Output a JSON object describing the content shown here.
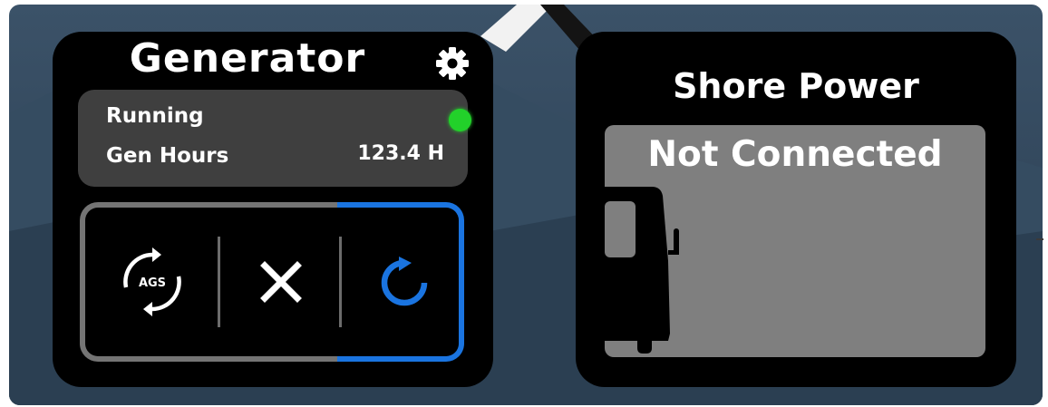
{
  "generator": {
    "title": "Generator",
    "status_label": "Running",
    "status_color": "#22d12a",
    "hours_label": "Gen Hours",
    "hours_value": "123.4 H",
    "settings_icon": "gear-icon",
    "modes": [
      {
        "name": "AGS",
        "label": "AGS",
        "icon": "ags-cycle-icon"
      },
      {
        "name": "Off",
        "icon": "close-icon"
      },
      {
        "name": "Auto",
        "icon": "refresh-icon",
        "active": true
      }
    ],
    "active_color": "#1a74e0"
  },
  "shore_power": {
    "title": "Shore Power",
    "status": "Not Connected",
    "icon": "rv-icon"
  }
}
